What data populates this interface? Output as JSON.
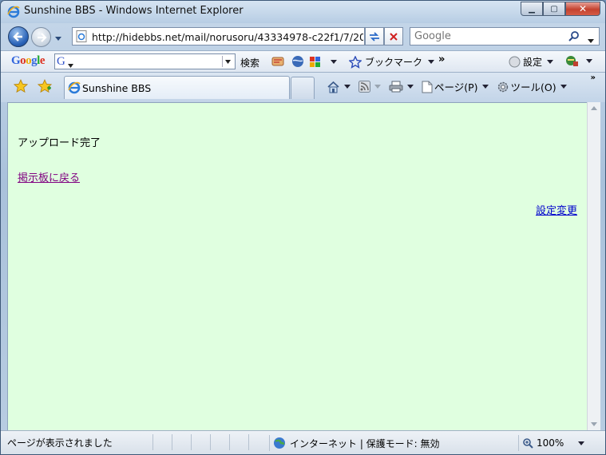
{
  "window": {
    "title": "Sunshine BBS - Windows Internet Explorer"
  },
  "address": {
    "url": "http://hidebbs.net/mail/norusoru/43334978-c22f1/7/20"
  },
  "search": {
    "placeholder": "Google"
  },
  "google_toolbar": {
    "logo": "Google",
    "search_button": "検索",
    "bookmark_label": "ブックマーク",
    "settings_label": "設定"
  },
  "tabs": [
    {
      "label": "Sunshine BBS"
    }
  ],
  "command_bar": {
    "page_label": "ページ(P)",
    "tools_label": "ツール(O)"
  },
  "content": {
    "message": "アップロード完了",
    "back_link": "掲示板に戻る",
    "settings_link": "設定変更",
    "background": "#e0ffe0"
  },
  "status_bar": {
    "text": "ページが表示されました",
    "zone": "インターネット | 保護モード: 無効",
    "zoom": "100%"
  }
}
